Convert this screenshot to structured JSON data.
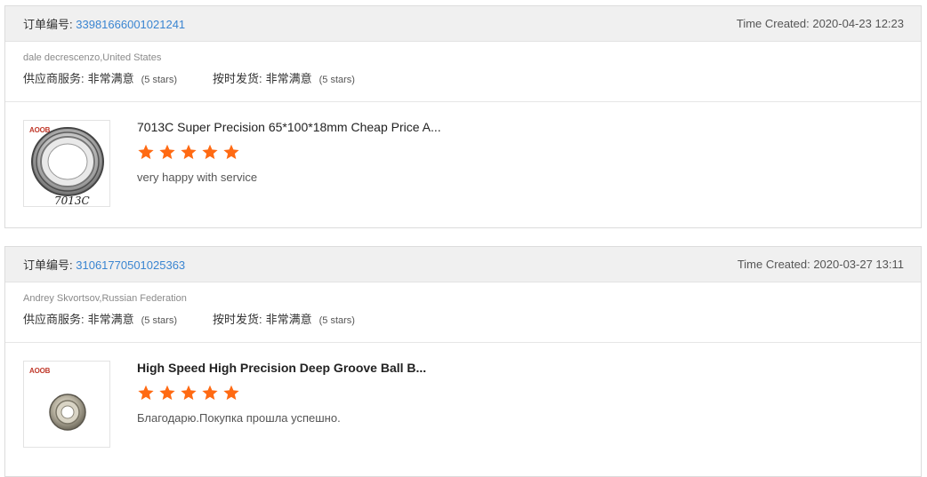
{
  "orders": [
    {
      "order_label": "订单编号:",
      "order_number": "33981666001021241",
      "time_created": "Time Created: 2020-04-23 12:23",
      "buyer": "dale decrescenzo,United States",
      "ratings": [
        {
          "label": "供应商服务:",
          "value": "非常满意",
          "stars_text": "(5 stars)"
        },
        {
          "label": "按时发货:",
          "value": "非常满意",
          "stars_text": "(5 stars)"
        }
      ],
      "product": {
        "thumb_logo": "AOOB",
        "thumb_handwriting": "7013C",
        "title": "7013C Super Precision 65*100*18mm Cheap Price A...",
        "rating": 5,
        "review": "very happy with service"
      }
    },
    {
      "order_label": "订单编号:",
      "order_number": "31061770501025363",
      "time_created": "Time Created: 2020-03-27 13:11",
      "buyer": "Andrey Skvortsov,Russian Federation",
      "ratings": [
        {
          "label": "供应商服务:",
          "value": "非常满意",
          "stars_text": "(5 stars)"
        },
        {
          "label": "按时发货:",
          "value": "非常满意",
          "stars_text": "(5 stars)"
        }
      ],
      "product": {
        "thumb_logo": "AOOB",
        "title": "High Speed High Precision Deep Groove Ball B...",
        "rating": 5,
        "review": "Благодарю.Покупка прошла успешно."
      }
    }
  ],
  "colors": {
    "star": "#ff6a13",
    "link": "#3a85d1",
    "header_bg": "#f0f0f0"
  },
  "icons": {
    "star": "star-icon"
  }
}
